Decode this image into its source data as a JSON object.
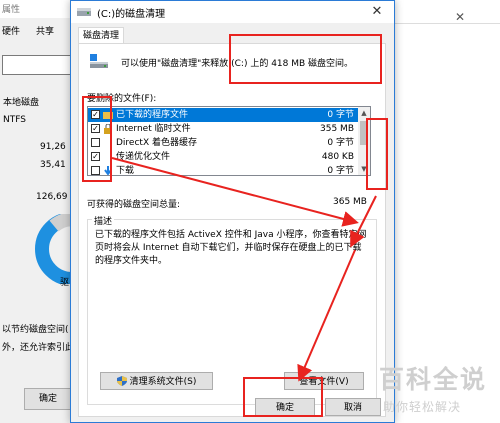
{
  "background_window": {
    "title_fragment": "属性",
    "tabs": [
      "硬件",
      "共享"
    ],
    "local_disk_label": "本地磁盘",
    "fs_label": "NTFS",
    "val1": "91,26",
    "val2": "35,41",
    "val3": "126,69",
    "drive_letter": "驱",
    "compress_fragment": "以节约磁盘空间(",
    "index_fragment": "外，还允许索引此",
    "ok_label": "确定"
  },
  "dialog": {
    "title": "(C:)的磁盘清理",
    "tab_label": "磁盘清理",
    "intro_text": "可以使用\"磁盘清理\"来释放 (C:) 上的 418 MB 磁盘空间。",
    "files_label": "要删除的文件(F):",
    "items": [
      {
        "name": "已下载的程序文件",
        "size": "0 字节",
        "checked": true
      },
      {
        "name": "Internet 临时文件",
        "size": "355 MB",
        "checked": true
      },
      {
        "name": "DirectX 着色器缓存",
        "size": "0 字节",
        "checked": false
      },
      {
        "name": "传递优化文件",
        "size": "480 KB",
        "checked": true
      },
      {
        "name": "下载",
        "size": "0 字节",
        "checked": false
      }
    ],
    "total_label": "可获得的磁盘空间总量:",
    "total_value": "365 MB",
    "desc_label": "描述",
    "description": "已下载的程序文件包括 ActiveX 控件和 Java 小程序，你查看特定网页时将会从 Internet 自动下载它们，并临时保存在硬盘上的已下载的程序文件夹中。",
    "clean_system_button": "清理系统文件(S)",
    "view_files_button": "查看文件(V)",
    "ok_button": "确定",
    "cancel_button": "取消"
  },
  "watermark": {
    "big": "百科全说",
    "small": "助你轻松解决"
  },
  "colors": {
    "selection": "#0078d7",
    "annotation": "#e8231f"
  }
}
